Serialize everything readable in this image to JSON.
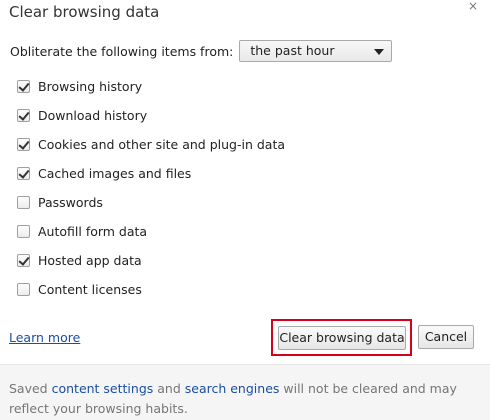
{
  "dialog": {
    "title": "Clear browsing data",
    "close_glyph": "×"
  },
  "time_range": {
    "label": "Obliterate the following items from:",
    "selected": "the past hour"
  },
  "items": [
    {
      "label": "Browsing history",
      "checked": true
    },
    {
      "label": "Download history",
      "checked": true
    },
    {
      "label": "Cookies and other site and plug-in data",
      "checked": true
    },
    {
      "label": "Cached images and files",
      "checked": true
    },
    {
      "label": "Passwords",
      "checked": false
    },
    {
      "label": "Autofill form data",
      "checked": false
    },
    {
      "label": "Hosted app data",
      "checked": true
    },
    {
      "label": "Content licenses",
      "checked": false
    }
  ],
  "actions": {
    "learn_more": "Learn more",
    "clear_label": "Clear browsing data",
    "cancel_label": "Cancel"
  },
  "footer": {
    "prefix": "Saved ",
    "link1": "content settings",
    "middle": " and ",
    "link2": "search engines",
    "suffix": " will not be cleared and may reflect your browsing habits."
  },
  "colors": {
    "link": "#1a4fa3",
    "highlight": "#d6001c",
    "footer_bg": "#f5f5f5"
  }
}
